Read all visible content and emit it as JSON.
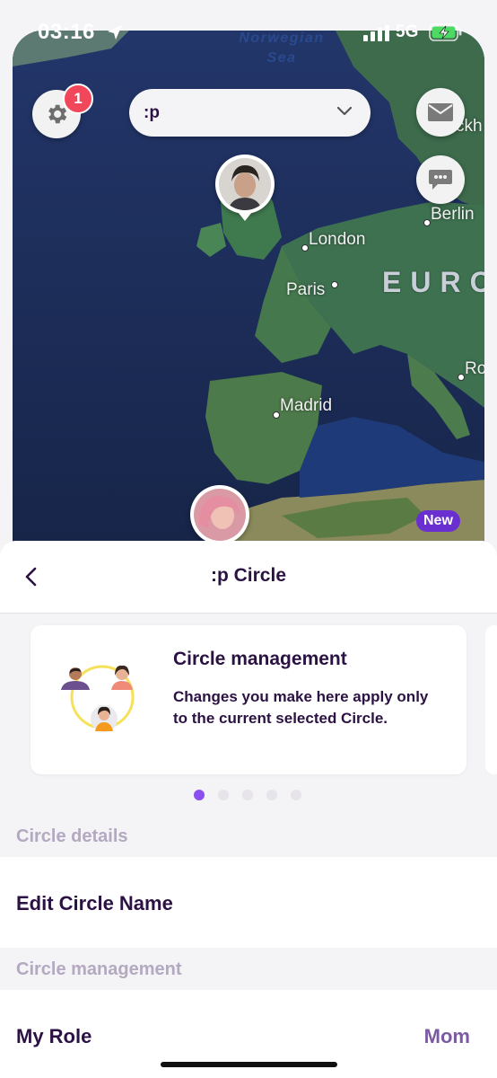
{
  "status_bar": {
    "time": "03:16",
    "network": "5G"
  },
  "map": {
    "sea_label_lines": [
      "Norwegian",
      "Sea"
    ],
    "cities": [
      "London",
      "Paris",
      "Madrid",
      "Berlin",
      "Ro",
      "ckh"
    ],
    "region_label": "EURO",
    "notification_count": "1",
    "new_badge": "New"
  },
  "circle_selector": {
    "value": ":p"
  },
  "sheet": {
    "title": ":p Circle",
    "card": {
      "title": "Circle management",
      "body": "Changes you make here apply only to the current selected Circle."
    },
    "pagination": {
      "count": 5,
      "active": 0
    },
    "sections": [
      {
        "label": "Circle details",
        "rows": [
          {
            "label": "Edit Circle Name",
            "value": ""
          }
        ]
      },
      {
        "label": "Circle management",
        "rows": [
          {
            "label": "My Role",
            "value": "Mom"
          }
        ]
      }
    ]
  },
  "colors": {
    "accent": "#8a4ff0",
    "text_primary": "#2b1243",
    "badge_red": "#f2475b",
    "new_badge": "#6a2fd1"
  }
}
